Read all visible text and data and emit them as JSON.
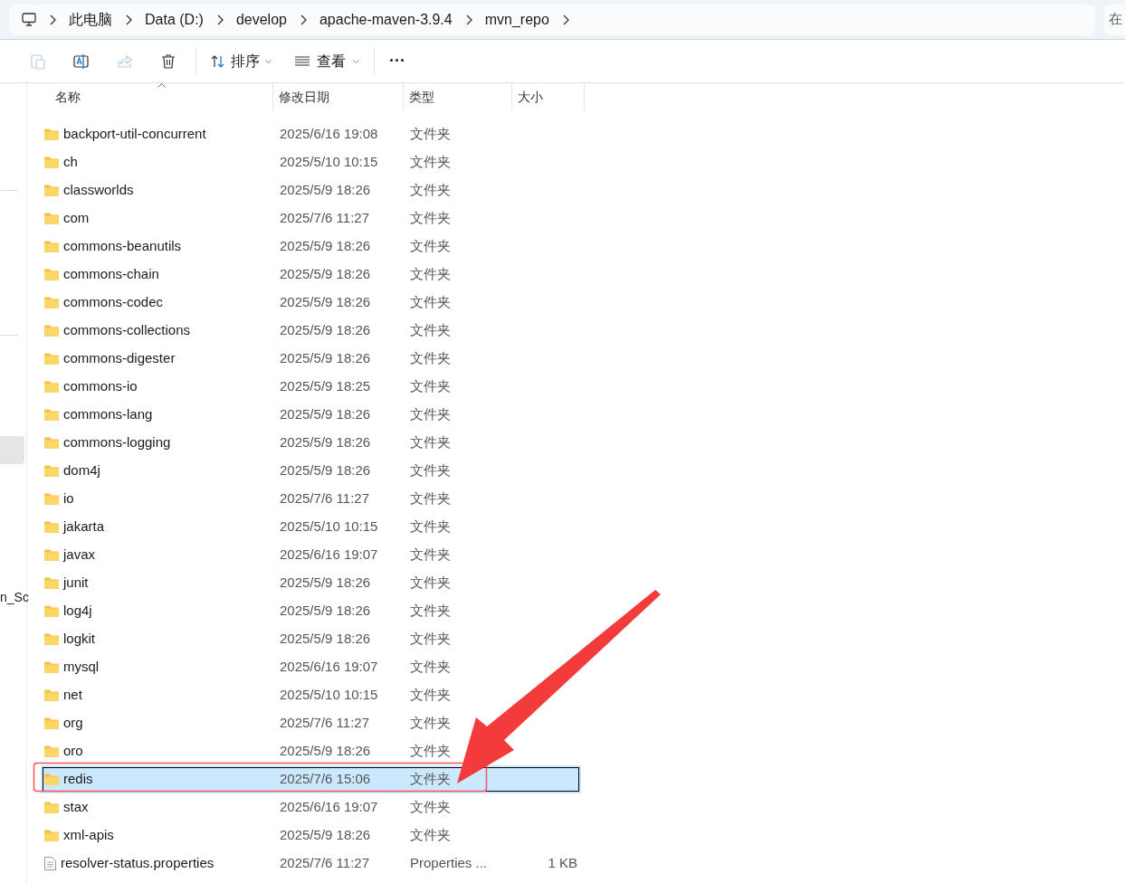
{
  "breadcrumbs": [
    "此电脑",
    "Data (D:)",
    "develop",
    "apache-maven-3.9.4",
    "mvn_repo"
  ],
  "search": {
    "placeholder": "在"
  },
  "toolbar": [
    {
      "kind": "paste",
      "disabled": true
    },
    {
      "kind": "rename",
      "disabled": false
    },
    {
      "kind": "share",
      "disabled": true
    },
    {
      "kind": "delete",
      "disabled": false
    },
    {
      "kind": "sort",
      "label": "排序"
    },
    {
      "kind": "view",
      "label": "查看"
    },
    {
      "kind": "more",
      "label": "···"
    }
  ],
  "nav_pane": {
    "cut_label": "n_Sc"
  },
  "columns": [
    "名称",
    "修改日期",
    "类型",
    "大小"
  ],
  "rows": [
    {
      "kind": "folder",
      "name": "backport-util-concurrent",
      "date": "2025/6/16 19:08",
      "type": "文件夹",
      "selected": false
    },
    {
      "kind": "folder",
      "name": "ch",
      "date": "2025/5/10 10:15",
      "type": "文件夹",
      "selected": false
    },
    {
      "kind": "folder",
      "name": "classworlds",
      "date": "2025/5/9 18:26",
      "type": "文件夹",
      "selected": false
    },
    {
      "kind": "folder",
      "name": "com",
      "date": "2025/7/6 11:27",
      "type": "文件夹",
      "selected": false
    },
    {
      "kind": "folder",
      "name": "commons-beanutils",
      "date": "2025/5/9 18:26",
      "type": "文件夹",
      "selected": false
    },
    {
      "kind": "folder",
      "name": "commons-chain",
      "date": "2025/5/9 18:26",
      "type": "文件夹",
      "selected": false
    },
    {
      "kind": "folder",
      "name": "commons-codec",
      "date": "2025/5/9 18:26",
      "type": "文件夹",
      "selected": false
    },
    {
      "kind": "folder",
      "name": "commons-collections",
      "date": "2025/5/9 18:26",
      "type": "文件夹",
      "selected": false
    },
    {
      "kind": "folder",
      "name": "commons-digester",
      "date": "2025/5/9 18:26",
      "type": "文件夹",
      "selected": false
    },
    {
      "kind": "folder",
      "name": "commons-io",
      "date": "2025/5/9 18:25",
      "type": "文件夹",
      "selected": false
    },
    {
      "kind": "folder",
      "name": "commons-lang",
      "date": "2025/5/9 18:26",
      "type": "文件夹",
      "selected": false
    },
    {
      "kind": "folder",
      "name": "commons-logging",
      "date": "2025/5/9 18:26",
      "type": "文件夹",
      "selected": false
    },
    {
      "kind": "folder",
      "name": "dom4j",
      "date": "2025/5/9 18:26",
      "type": "文件夹",
      "selected": false
    },
    {
      "kind": "folder",
      "name": "io",
      "date": "2025/7/6 11:27",
      "type": "文件夹",
      "selected": false
    },
    {
      "kind": "folder",
      "name": "jakarta",
      "date": "2025/5/10 10:15",
      "type": "文件夹",
      "selected": false
    },
    {
      "kind": "folder",
      "name": "javax",
      "date": "2025/6/16 19:07",
      "type": "文件夹",
      "selected": false
    },
    {
      "kind": "folder",
      "name": "junit",
      "date": "2025/5/9 18:26",
      "type": "文件夹",
      "selected": false
    },
    {
      "kind": "folder",
      "name": "log4j",
      "date": "2025/5/9 18:26",
      "type": "文件夹",
      "selected": false
    },
    {
      "kind": "folder",
      "name": "logkit",
      "date": "2025/5/9 18:26",
      "type": "文件夹",
      "selected": false
    },
    {
      "kind": "folder",
      "name": "mysql",
      "date": "2025/6/16 19:07",
      "type": "文件夹",
      "selected": false
    },
    {
      "kind": "folder",
      "name": "net",
      "date": "2025/5/10 10:15",
      "type": "文件夹",
      "selected": false
    },
    {
      "kind": "folder",
      "name": "org",
      "date": "2025/7/6 11:27",
      "type": "文件夹",
      "selected": false
    },
    {
      "kind": "folder",
      "name": "oro",
      "date": "2025/5/9 18:26",
      "type": "文件夹",
      "selected": false
    },
    {
      "kind": "folder",
      "name": "redis",
      "date": "2025/7/6 15:06",
      "type": "文件夹",
      "selected": true
    },
    {
      "kind": "folder",
      "name": "stax",
      "date": "2025/6/16 19:07",
      "type": "文件夹",
      "selected": false
    },
    {
      "kind": "folder",
      "name": "xml-apis",
      "date": "2025/5/9 18:26",
      "type": "文件夹",
      "selected": false
    },
    {
      "kind": "file",
      "name": "resolver-status.properties",
      "date": "2025/7/6 11:27",
      "type": "Properties ...",
      "size": "1 KB",
      "selected": false
    }
  ]
}
